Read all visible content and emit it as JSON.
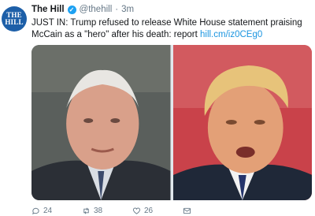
{
  "tweet": {
    "avatar": {
      "line1": "THE",
      "line2": "HILL"
    },
    "display_name": "The Hill",
    "verified_icon": "verified-badge-icon",
    "handle": "@thehill",
    "separator": "·",
    "time": "3m",
    "text": "JUST IN: Trump refused to release White House statement praising McCain as a \"hero\" after his death: report ",
    "link": "hill.cm/iz0CEg0"
  },
  "actions": {
    "reply": {
      "icon": "reply-icon",
      "count": "24"
    },
    "retweet": {
      "icon": "retweet-icon",
      "count": "38"
    },
    "like": {
      "icon": "heart-icon",
      "count": "26"
    },
    "message": {
      "icon": "direct-message-icon"
    }
  },
  "colors": {
    "brand_blue": "#1da1f2",
    "link": "#1b95e0",
    "muted": "#657786",
    "avatar_bg": "#1d5fa8"
  }
}
